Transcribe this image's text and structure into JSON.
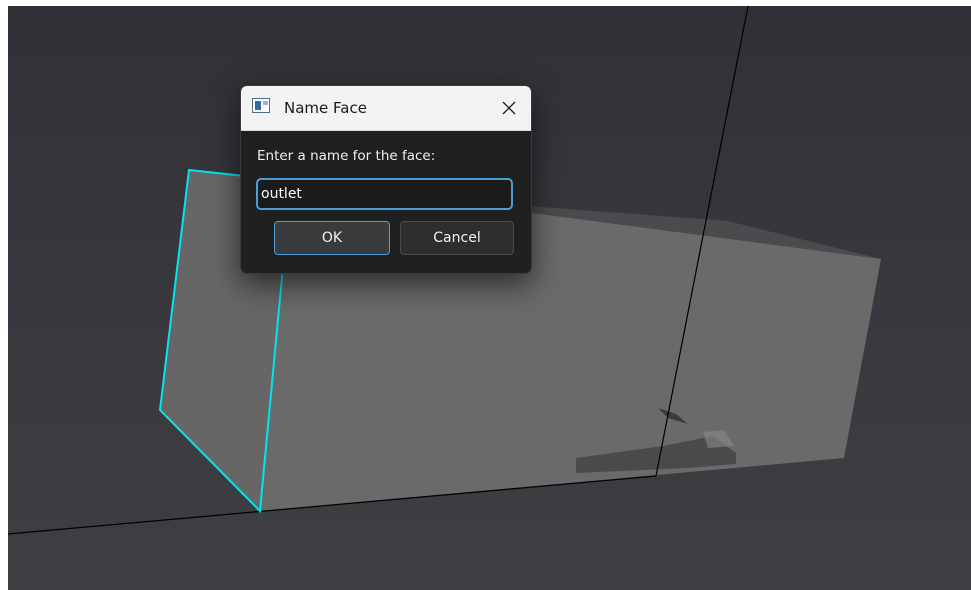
{
  "viewport": {
    "background_color": "#35363b",
    "face_color": "#666666",
    "highlight_color": "#00e5f0",
    "axis_color": "#000000"
  },
  "dialog": {
    "title": "Name Face",
    "icon": "window-app-icon",
    "close_icon": "close-icon",
    "prompt": "Enter a name for the face:",
    "input_value": "outlet",
    "ok_label": "OK",
    "cancel_label": "Cancel",
    "accent_color": "#4a9fd8"
  }
}
